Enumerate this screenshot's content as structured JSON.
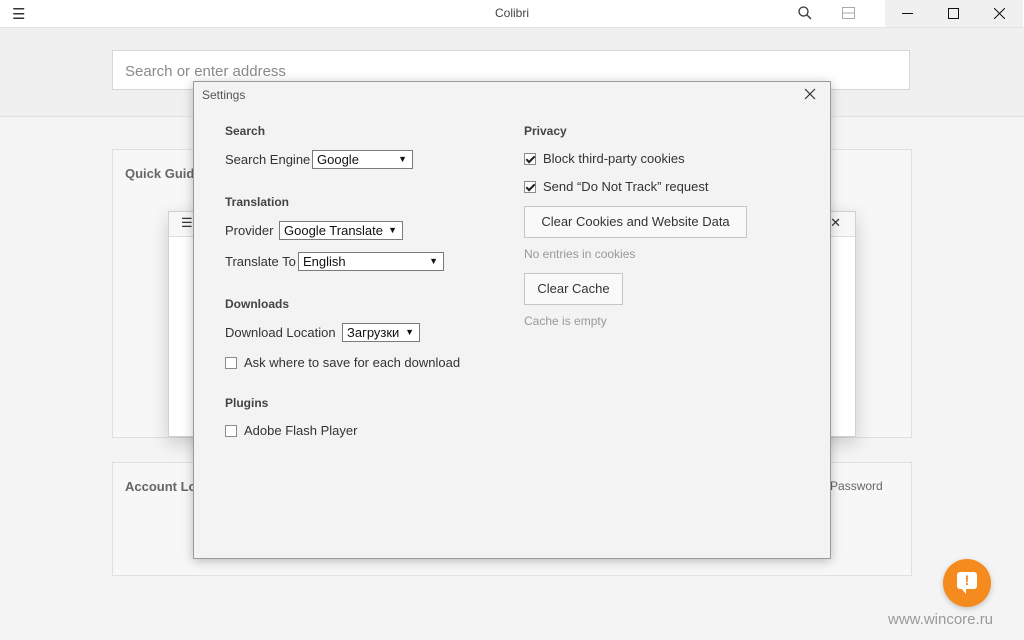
{
  "app": {
    "title": "Colibri",
    "menu_icon": "hamburger-icon",
    "search_icon": "search-icon",
    "tabs_icon": "tabs-icon"
  },
  "address_bar": {
    "placeholder": "Search or enter address"
  },
  "background": {
    "quick_guide_title": "Quick Guid",
    "account_title": "Account Lo",
    "forgot_password": "got Password"
  },
  "settings": {
    "title": "Settings",
    "search": {
      "section": "Search",
      "engine_label": "Search Engine",
      "engine_value": "Google"
    },
    "translation": {
      "section": "Translation",
      "provider_label": "Provider",
      "provider_value": "Google Translate",
      "translate_to_label": "Translate To",
      "translate_to_value": "English"
    },
    "downloads": {
      "section": "Downloads",
      "location_label": "Download Location",
      "location_value": "Загрузки",
      "ask_label": "Ask where to save for each download",
      "ask_checked": false
    },
    "plugins": {
      "section": "Plugins",
      "flash_label": "Adobe Flash Player",
      "flash_checked": false
    },
    "privacy": {
      "section": "Privacy",
      "block_cookies_label": "Block third-party cookies",
      "block_cookies_checked": true,
      "dnt_label": "Send “Do Not Track” request",
      "dnt_checked": true,
      "clear_cookies_button": "Clear Cookies and Website Data",
      "cookies_status": "No entries in cookies",
      "clear_cache_button": "Clear Cache",
      "cache_status": "Cache is empty"
    }
  },
  "watermark": "www.wincore.ru",
  "colors": {
    "feedback_button": "#f58a1f"
  }
}
